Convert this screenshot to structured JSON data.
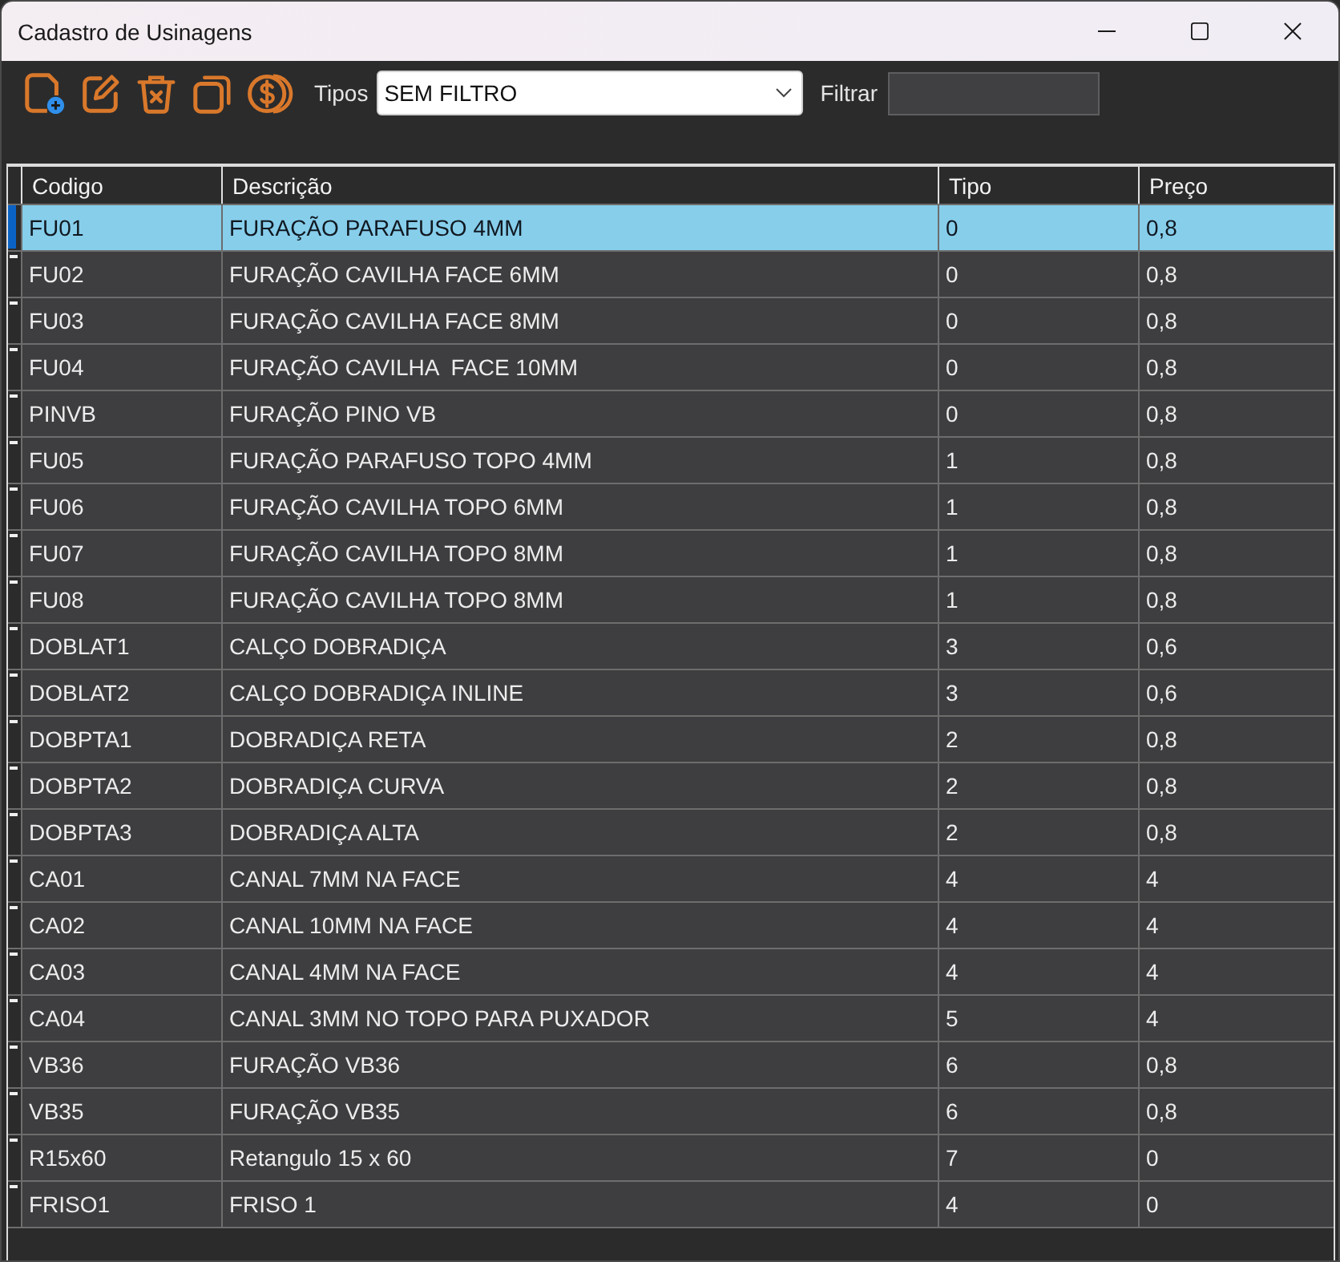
{
  "window": {
    "title": "Cadastro de Usinagens"
  },
  "filters": {
    "tipos": {
      "label": "Tipos",
      "value": "SEM FILTRO"
    },
    "filtrar": {
      "label": "Filtrar"
    }
  },
  "table": {
    "columns": [
      "Codigo",
      "Descrição",
      "Tipo",
      "Preço"
    ],
    "rows": [
      {
        "cells": [
          "FU01",
          "FURAÇÃO PARAFUSO 4MM",
          "0",
          "0,8"
        ],
        "selected": true
      },
      {
        "cells": [
          "FU02",
          "FURAÇÃO CAVILHA FACE 6MM",
          "0",
          "0,8"
        ],
        "selected": false
      },
      {
        "cells": [
          "FU03",
          "FURAÇÃO CAVILHA FACE 8MM",
          "0",
          "0,8"
        ],
        "selected": false
      },
      {
        "cells": [
          "FU04",
          "FURAÇÃO CAVILHA  FACE 10MM",
          "0",
          "0,8"
        ],
        "selected": false
      },
      {
        "cells": [
          "PINVB",
          "FURAÇÃO PINO VB",
          "0",
          "0,8"
        ],
        "selected": false
      },
      {
        "cells": [
          "FU05",
          "FURAÇÃO PARAFUSO TOPO 4MM",
          "1",
          "0,8"
        ],
        "selected": false
      },
      {
        "cells": [
          "FU06",
          "FURAÇÃO CAVILHA TOPO 6MM",
          "1",
          "0,8"
        ],
        "selected": false
      },
      {
        "cells": [
          "FU07",
          "FURAÇÃO CAVILHA TOPO 8MM",
          "1",
          "0,8"
        ],
        "selected": false
      },
      {
        "cells": [
          "FU08",
          "FURAÇÃO CAVILHA TOPO 8MM",
          "1",
          "0,8"
        ],
        "selected": false
      },
      {
        "cells": [
          "DOBLAT1",
          "CALÇO DOBRADIÇA",
          "3",
          "0,6"
        ],
        "selected": false
      },
      {
        "cells": [
          "DOBLAT2",
          "CALÇO DOBRADIÇA INLINE",
          "3",
          "0,6"
        ],
        "selected": false
      },
      {
        "cells": [
          "DOBPTA1",
          "DOBRADIÇA RETA",
          "2",
          "0,8"
        ],
        "selected": false
      },
      {
        "cells": [
          "DOBPTA2",
          "DOBRADIÇA CURVA",
          "2",
          "0,8"
        ],
        "selected": false
      },
      {
        "cells": [
          "DOBPTA3",
          "DOBRADIÇA ALTA",
          "2",
          "0,8"
        ],
        "selected": false
      },
      {
        "cells": [
          "CA01",
          "CANAL 7MM NA FACE",
          "4",
          "4"
        ],
        "selected": false
      },
      {
        "cells": [
          "CA02",
          "CANAL 10MM NA FACE",
          "4",
          "4"
        ],
        "selected": false
      },
      {
        "cells": [
          "CA03",
          "CANAL 4MM NA FACE",
          "4",
          "4"
        ],
        "selected": false
      },
      {
        "cells": [
          "CA04",
          "CANAL 3MM NO TOPO PARA PUXADOR",
          "5",
          "4"
        ],
        "selected": false
      },
      {
        "cells": [
          "VB36",
          "FURAÇÃO VB36",
          "6",
          "0,8"
        ],
        "selected": false
      },
      {
        "cells": [
          "VB35",
          "FURAÇÃO VB35",
          "6",
          "0,8"
        ],
        "selected": false
      },
      {
        "cells": [
          "R15x60",
          "Retangulo 15 x 60",
          "7",
          "0"
        ],
        "selected": false
      },
      {
        "cells": [
          "FRISO1",
          "FRISO 1",
          "4",
          "0"
        ],
        "selected": false
      }
    ]
  }
}
